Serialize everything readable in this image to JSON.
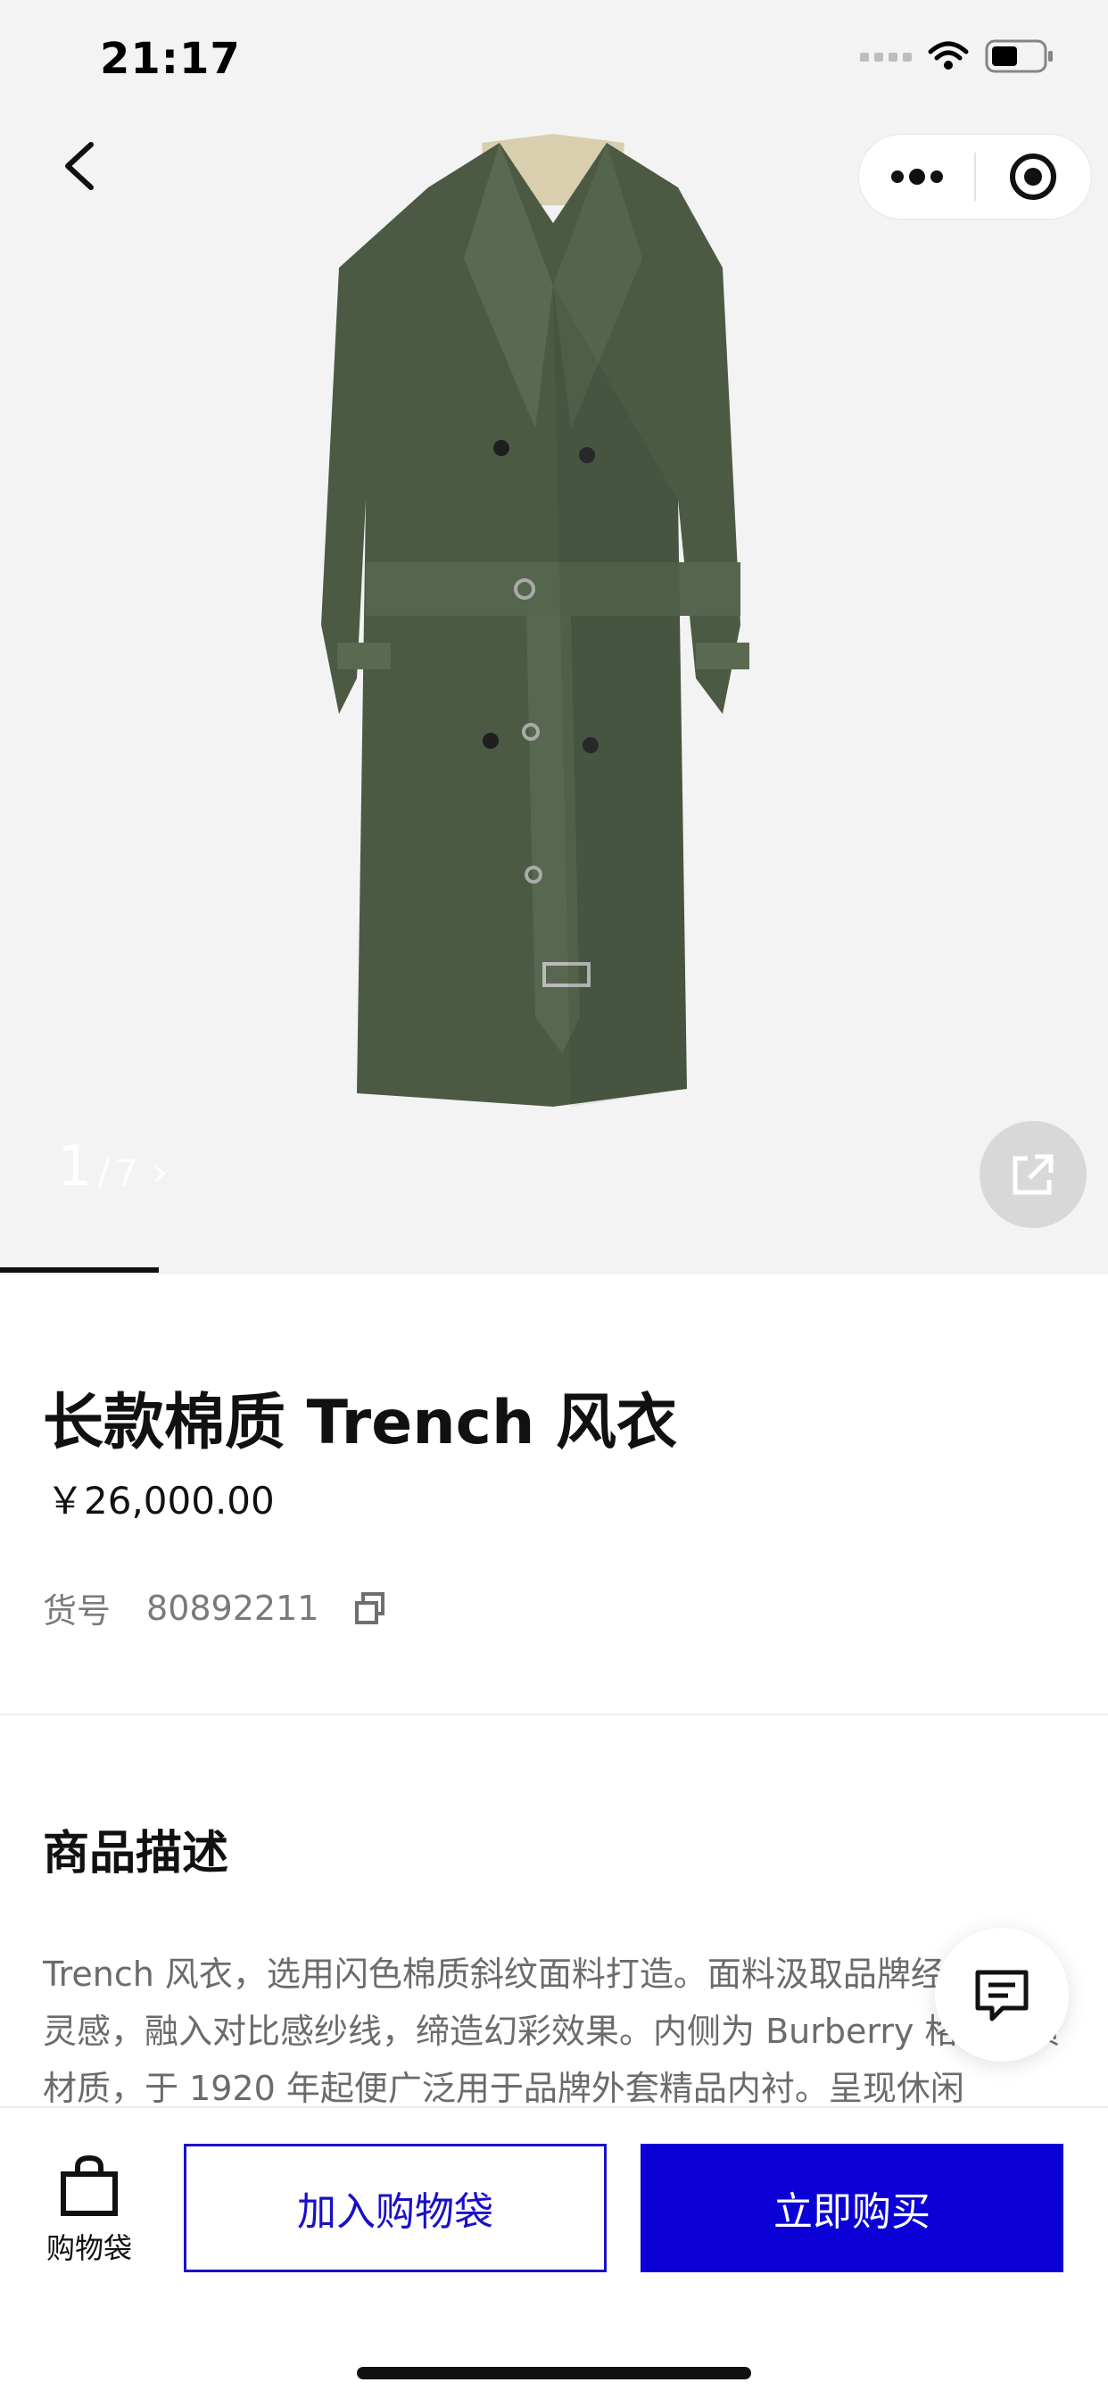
{
  "status_bar": {
    "time": "21:17"
  },
  "gallery": {
    "current": "1",
    "separator": "/",
    "total": "7",
    "progress_fraction": 0.143
  },
  "product": {
    "title": "长款棉质 Trench 风衣",
    "price": "￥26,000.00",
    "sku_label": "货号",
    "sku_value": "80892211"
  },
  "description": {
    "heading": "商品描述",
    "text": "Trench 风衣，选用闪色棉质斜纹面料打造。面料汲取品牌经典图案灵感，融入对比感纱线，缔造幻彩效果。内侧为 Burberry 格纹棉质材质，于 1920 年起便广泛用于品牌外套精品内衬。呈现休闲"
  },
  "bottom_bar": {
    "bag_label": "购物袋",
    "add_to_bag": "加入购物袋",
    "buy_now": "立即购买"
  },
  "colors": {
    "accent": "#0b00d6",
    "coat": "#4c5a44"
  },
  "icons": [
    "back-arrow-icon",
    "more-dots-icon",
    "target-icon",
    "share-icon",
    "copy-icon",
    "chat-icon",
    "shopping-bag-icon",
    "wifi-icon",
    "battery-icon",
    "signal-icon"
  ]
}
